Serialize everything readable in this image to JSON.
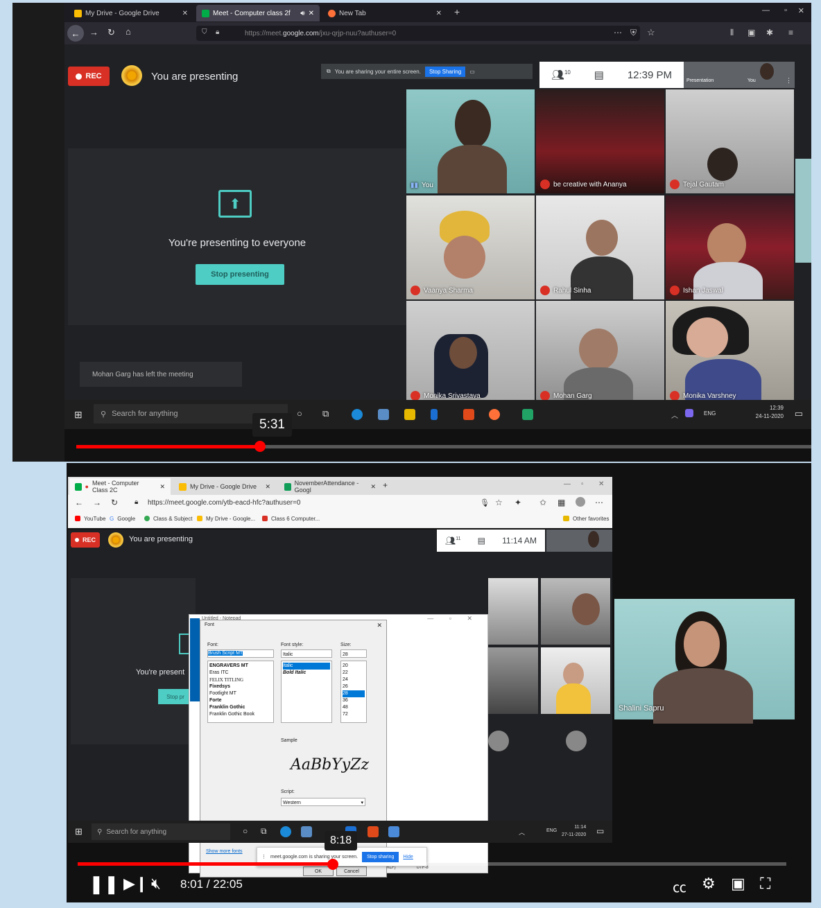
{
  "top": {
    "tabs": [
      {
        "label": "My Drive - Google Drive"
      },
      {
        "label": "Meet - Computer class 2f"
      },
      {
        "label": "New Tab"
      }
    ],
    "url_prefix": "https://meet.",
    "url_domain": "google.com",
    "url_suffix": "/jxu-qrjp-nuu?authuser=0",
    "rec_label": "REC",
    "presenting_label": "You are presenting",
    "share_notice": "You are sharing your entire screen.",
    "stop_sharing_label": "Stop Sharing",
    "participants_count": "10",
    "time": "12:39 PM",
    "presentation_label": "Presentation",
    "you_label": "You",
    "present_card_text": "You're presenting to everyone",
    "stop_presenting_label": "Stop presenting",
    "toast_text": "Mohan Garg has left the meeting",
    "participants": [
      {
        "name": "You"
      },
      {
        "name": "be creative with Ananya"
      },
      {
        "name": "Tejal Gautam"
      },
      {
        "name": "Vaanya Sharma"
      },
      {
        "name": "Rahul Sinha"
      },
      {
        "name": "Ishan Jaswal"
      },
      {
        "name": "Monika Srivastava"
      },
      {
        "name": "Mohan Garg"
      },
      {
        "name": "Monika Varshney"
      }
    ],
    "taskbar_search": "Search for anything",
    "tray_lang": "ENG",
    "tray_time": "12:39",
    "tray_date": "24-11-2020",
    "tooltip_time": "5:31",
    "progress_fraction": 0.25
  },
  "bottom": {
    "tabs": [
      {
        "label": "Meet - Computer Class 2C"
      },
      {
        "label": "My Drive - Google Drive"
      },
      {
        "label": "NovemberAttendance - Googl"
      }
    ],
    "url": "https://meet.google.com/ytb-eacd-hfc?authuser=0",
    "bookmarks": [
      "YouTube",
      "Google",
      "Class & Subject",
      "My Drive - Google...",
      "Class 6 Computer..."
    ],
    "other_favorites": "Other favorites",
    "rec_label": "REC",
    "presenting_label": "You are presenting",
    "participants_count": "11",
    "time": "11:14 AM",
    "notepad_title": "Untitled - Notepad",
    "font_dialog": {
      "title": "Font",
      "font_label": "Font:",
      "font_value": "Brush Script MT",
      "fonts": [
        "ENGRAVERS MT",
        "Eras ITC",
        "FELIX TITLING",
        "Fixedsys",
        "Footlight MT",
        "Forte",
        "Franklin Gothic",
        "Franklin Gothic Book"
      ],
      "style_label": "Font style:",
      "style_value": "Italic",
      "styles": [
        "Italic",
        "Bold Italic"
      ],
      "size_label": "Size:",
      "size_value": "28",
      "sizes": [
        "20",
        "22",
        "24",
        "26",
        "28",
        "36",
        "48",
        "72"
      ],
      "sample_label": "Sample",
      "sample_text": "AaBbYyZz",
      "script_label": "Script:",
      "script_value": "Western",
      "show_more": "Show more fonts",
      "ok": "OK",
      "cancel": "Cancel"
    },
    "share_notice": "meet.google.com is sharing your screen.",
    "stop_sharing_label": "Stop sharing",
    "hide_label": "Hide",
    "status_items": [
      "Windows (CRLF)",
      "UTF-8"
    ],
    "present_partial": "You're present",
    "speaker_name": "Shalini Sapru",
    "taskbar_search": "Search for anything",
    "tray_lang": "ENG",
    "tray_time": "11:14",
    "tray_date": "27-11-2020",
    "tooltip_time": "8:18",
    "current_time": "8:01 / 22:05",
    "progress_fraction": 0.36
  }
}
